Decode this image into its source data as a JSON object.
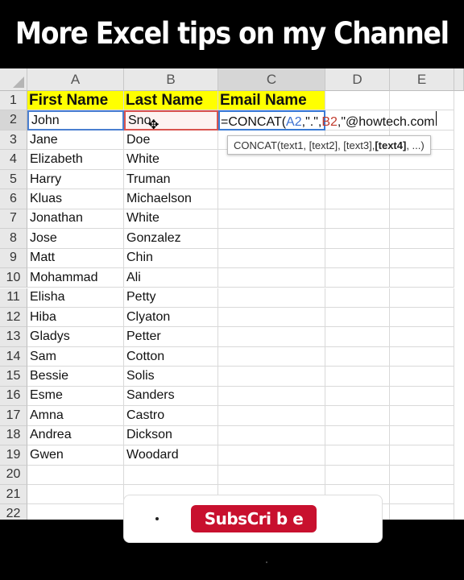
{
  "banner": {
    "title": "More Excel tips on my Channel"
  },
  "columns": [
    "A",
    "B",
    "C",
    "D",
    "E"
  ],
  "header_row": {
    "number": "1",
    "first": "First Name",
    "last": "Last Name",
    "email": "Email Name"
  },
  "rows": [
    {
      "n": "2",
      "first": "John",
      "last": "Sno"
    },
    {
      "n": "3",
      "first": "Jane",
      "last": "Doe"
    },
    {
      "n": "4",
      "first": "Elizabeth",
      "last": "White"
    },
    {
      "n": "5",
      "first": "Harry",
      "last": "Truman"
    },
    {
      "n": "6",
      "first": "Kluas",
      "last": "Michaelson"
    },
    {
      "n": "7",
      "first": "Jonathan",
      "last": "White"
    },
    {
      "n": "8",
      "first": "Jose",
      "last": "Gonzalez"
    },
    {
      "n": "9",
      "first": "Matt",
      "last": "Chin"
    },
    {
      "n": "10",
      "first": "Mohammad",
      "last": "Ali"
    },
    {
      "n": "11",
      "first": "Elisha",
      "last": "Petty"
    },
    {
      "n": "12",
      "first": "Hiba",
      "last": "Clyaton"
    },
    {
      "n": "13",
      "first": "Gladys",
      "last": "Petter"
    },
    {
      "n": "14",
      "first": "Sam",
      "last": "Cotton"
    },
    {
      "n": "15",
      "first": "Bessie",
      "last": "Solis"
    },
    {
      "n": "16",
      "first": "Esme",
      "last": "Sanders"
    },
    {
      "n": "17",
      "first": "Amna",
      "last": "Castro"
    },
    {
      "n": "18",
      "first": "Andrea",
      "last": "Dickson"
    },
    {
      "n": "19",
      "first": "Gwen",
      "last": "Woodard"
    },
    {
      "n": "20",
      "first": "",
      "last": ""
    },
    {
      "n": "21",
      "first": "",
      "last": ""
    },
    {
      "n": "22",
      "first": "",
      "last": ""
    }
  ],
  "formula": {
    "prefix": "=CONCAT(",
    "ref_a": "A2",
    "mid": ",\".\",",
    "ref_b": "B2",
    "suffix": ",\"@howtech.com"
  },
  "tooltip": {
    "text": "CONCAT(text1, [text2], [text3], ",
    "bold": "[text4]",
    "end": ", ...)"
  },
  "subscribe": {
    "label": "SubsCri b e"
  },
  "colors": {
    "header_fill": "#ffff00",
    "ref_a": "#3a6fd0",
    "ref_b": "#c0392b",
    "subscribe": "#c8102e"
  }
}
